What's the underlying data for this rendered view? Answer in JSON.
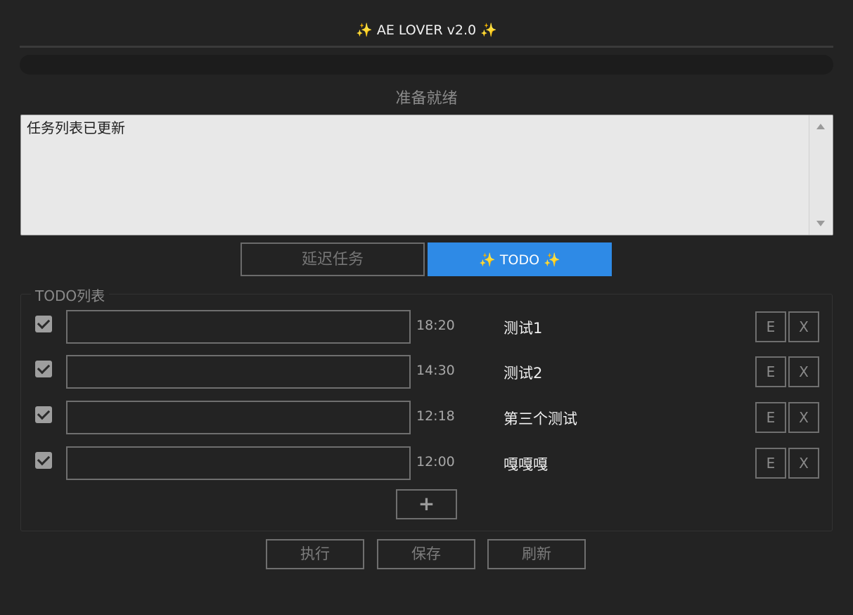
{
  "app": {
    "title": "✨ AE LOVER v2.0 ✨"
  },
  "progress": {
    "value": 0
  },
  "status": {
    "text": "准备就绪"
  },
  "log": {
    "text": "任务列表已更新"
  },
  "tabs": {
    "delay_label": "延迟任务",
    "todo_label": "✨ TODO ✨",
    "active": "todo"
  },
  "todo": {
    "legend": "TODO列表",
    "items": [
      {
        "checked": true,
        "input": "",
        "time": "18:20",
        "name": "测试1",
        "edit_label": "E",
        "delete_label": "X"
      },
      {
        "checked": true,
        "input": "",
        "time": "14:30",
        "name": "测试2",
        "edit_label": "E",
        "delete_label": "X"
      },
      {
        "checked": true,
        "input": "",
        "time": "12:18",
        "name": "第三个测试",
        "edit_label": "E",
        "delete_label": "X"
      },
      {
        "checked": true,
        "input": "",
        "time": "12:00",
        "name": "嘎嘎嘎",
        "edit_label": "E",
        "delete_label": "X"
      }
    ],
    "add_label": "+"
  },
  "actions": {
    "run_label": "执行",
    "save_label": "保存",
    "refresh_label": "刷新"
  },
  "colors": {
    "background": "#232323",
    "accent": "#2e8ae6",
    "log_background": "#e8e8e8"
  }
}
